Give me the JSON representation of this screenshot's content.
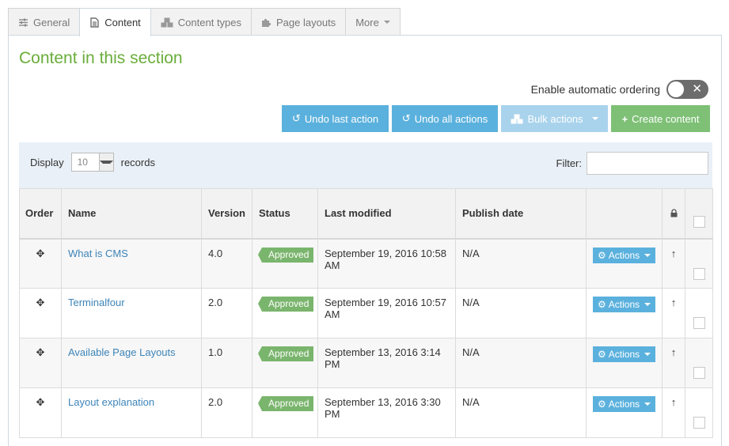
{
  "tabs": [
    {
      "label": "General",
      "icon": "sliders-icon"
    },
    {
      "label": "Content",
      "icon": "document-icon"
    },
    {
      "label": "Content types",
      "icon": "cubes-icon"
    },
    {
      "label": "Page layouts",
      "icon": "puzzle-icon"
    },
    {
      "label": "More",
      "icon": "chevron-down-icon"
    }
  ],
  "title": "Content in this section",
  "ordering": {
    "label": "Enable automatic ordering",
    "enabled": false
  },
  "buttons": {
    "undo_last": "Undo last action",
    "undo_all": "Undo all actions",
    "bulk": "Bulk actions",
    "create": "Create content"
  },
  "display": {
    "prefix": "Display",
    "value": "10",
    "suffix": "records"
  },
  "filter": {
    "label": "Filter:",
    "value": ""
  },
  "columns": {
    "order": "Order",
    "name": "Name",
    "version": "Version",
    "status": "Status",
    "last_modified": "Last modified",
    "publish_date": "Publish date"
  },
  "rows": [
    {
      "name": "What is CMS",
      "version": "4.0",
      "status": "Approved",
      "modified": "September 19, 2016 10:58 AM",
      "publish": "N/A",
      "actions": "Actions"
    },
    {
      "name": "Terminalfour",
      "version": "2.0",
      "status": "Approved",
      "modified": "September 19, 2016 10:57 AM",
      "publish": "N/A",
      "actions": "Actions"
    },
    {
      "name": "Available Page Layouts",
      "version": "1.0",
      "status": "Approved",
      "modified": "September 13, 2016 3:14 PM",
      "publish": "N/A",
      "actions": "Actions"
    },
    {
      "name": "Layout explanation",
      "version": "2.0",
      "status": "Approved",
      "modified": "September 13, 2016 3:30 PM",
      "publish": "N/A",
      "actions": "Actions"
    }
  ],
  "colors": {
    "accent_green": "#6aad3a",
    "button_blue": "#5bb1dd",
    "button_green": "#7ec076",
    "status_green": "#7ab56d",
    "link": "#3d84b8"
  }
}
